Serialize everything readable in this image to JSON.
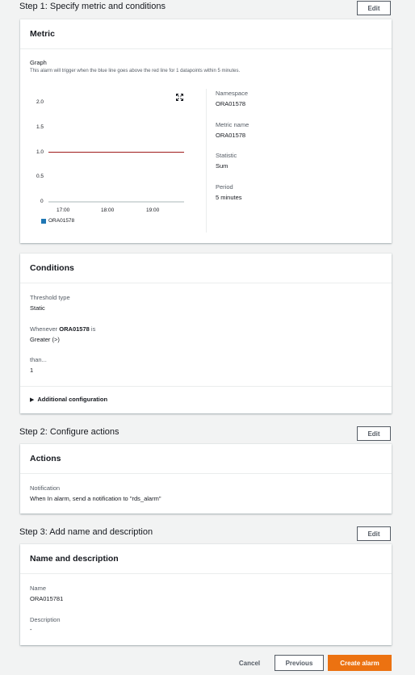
{
  "step1": {
    "title": "Step 1: Specify metric and conditions",
    "edit_label": "Edit",
    "metric_panel": {
      "heading": "Metric",
      "graph_label": "Graph",
      "graph_description": "This alarm will trigger when the blue line goes above the red line for 1 datapoints within 5 minutes.",
      "expand_icon": "expand-icon",
      "details": {
        "namespace_label": "Namespace",
        "namespace_value": "ORA01578",
        "metric_name_label": "Metric name",
        "metric_name_value": "ORA01578",
        "statistic_label": "Statistic",
        "statistic_value": "Sum",
        "period_label": "Period",
        "period_value": "5 minutes"
      }
    },
    "conditions_panel": {
      "heading": "Conditions",
      "threshold_type_label": "Threshold type",
      "threshold_type_value": "Static",
      "whenever_prefix": "Whenever",
      "whenever_metric": "ORA01578",
      "whenever_suffix": "is",
      "whenever_value": "Greater (>)",
      "than_label": "than...",
      "than_value": "1",
      "additional_config_label": "Additional configuration"
    }
  },
  "step2": {
    "title": "Step 2: Configure actions",
    "edit_label": "Edit",
    "actions_panel": {
      "heading": "Actions",
      "notification_label": "Notification",
      "notification_value": "When In alarm, send a notification to \"rds_alarm\""
    }
  },
  "step3": {
    "title": "Step 3: Add name and description",
    "edit_label": "Edit",
    "name_panel": {
      "heading": "Name and description",
      "name_label": "Name",
      "name_value": "ORA015781",
      "description_label": "Description",
      "description_value": "-"
    }
  },
  "footer": {
    "cancel_label": "Cancel",
    "previous_label": "Previous",
    "create_label": "Create alarm"
  },
  "colors": {
    "primary_button": "#ec7211",
    "metric_line": "#1f77b4",
    "threshold_line": "#9e1b1b"
  },
  "chart_data": {
    "type": "line",
    "x_tick_labels": [
      "17:00",
      "18:00",
      "19:00"
    ],
    "y_tick_labels": [
      "2.0",
      "1.5",
      "1.0",
      "0.5",
      "0"
    ],
    "ylim": [
      0,
      2.0
    ],
    "threshold": 1.0,
    "series": [
      {
        "name": "ORA01578",
        "color": "#1f77b4",
        "values": []
      }
    ],
    "legend_position": "bottom-left",
    "grid": false
  }
}
